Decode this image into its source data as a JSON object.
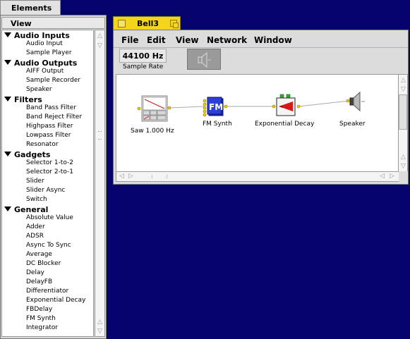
{
  "elements_window": {
    "tab_title": "Elements",
    "header": "View",
    "categories": [
      {
        "name": "Audio Inputs",
        "items": [
          "Audio Input",
          "Sample Player"
        ]
      },
      {
        "name": "Audio Outputs",
        "items": [
          "AIFF Output",
          "Sample Recorder",
          "Speaker"
        ]
      },
      {
        "name": "Filters",
        "items": [
          "Band Pass Filter",
          "Band Reject Filter",
          "Highpass Filter",
          "Lowpass Filter",
          "Resonator"
        ]
      },
      {
        "name": "Gadgets",
        "items": [
          "Selector 1-to-2",
          "Selector 2-to-1",
          "Slider",
          "Slider Async",
          "Switch"
        ]
      },
      {
        "name": "General",
        "items": [
          "Absolute Value",
          "Adder",
          "ADSR",
          "Async To Sync",
          "Average",
          "DC Blocker",
          "Delay",
          "DelayFB",
          "Differentiator",
          "Exponential Decay",
          "FBDelay",
          "FM Synth",
          "Integrator"
        ]
      }
    ]
  },
  "patch_window": {
    "title": "Bell3",
    "menu": [
      "File",
      "Edit",
      "View",
      "Network",
      "Window"
    ],
    "sample_rate_value": "44100 Hz",
    "sample_rate_label": "Sample Rate",
    "modules": [
      {
        "id": "saw",
        "label": "Saw 1.000 Hz",
        "icon": "saw-oscillator-icon"
      },
      {
        "id": "fm",
        "label": "FM Synth",
        "icon": "fm-synth-icon",
        "icon_text": "FM"
      },
      {
        "id": "decay",
        "label": "Exponential Decay",
        "icon": "exponential-decay-icon"
      },
      {
        "id": "speaker",
        "label": "Speaker",
        "icon": "speaker-icon"
      }
    ]
  },
  "colors": {
    "desktop": "#03036b",
    "titlebar": "#f3d51d",
    "fm_blue": "#2c3fd6",
    "decay_red": "#d81818",
    "port_yellow": "#f0d000",
    "port_green": "#2cb42c"
  }
}
